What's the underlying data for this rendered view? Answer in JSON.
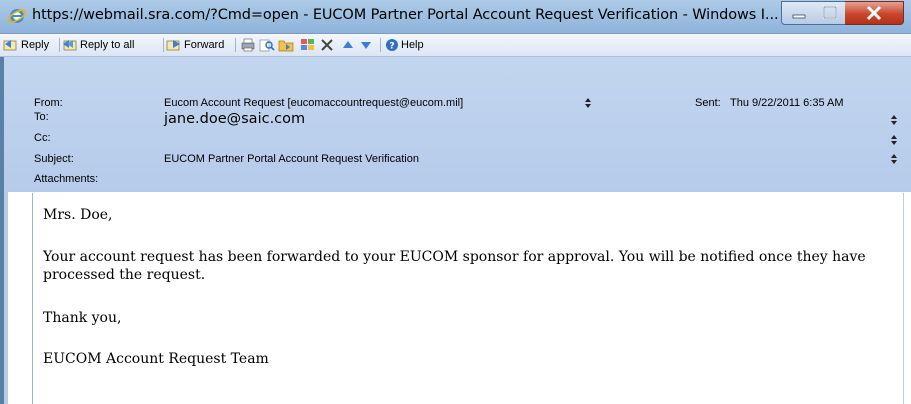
{
  "window": {
    "title": "https://webmail.sra.com/?Cmd=open - EUCOM Partner Portal Account Request Verification - Windows I..."
  },
  "toolbar": {
    "reply": "Reply",
    "reply_all": "Reply to all",
    "forward": "Forward",
    "help": "Help"
  },
  "header": {
    "from_label": "From:",
    "from_value": "Eucom Account Request [eucomaccountrequest@eucom.mil]",
    "sent_label": "Sent:",
    "sent_value": "Thu 9/22/2011 6:35 AM",
    "to_label": "To:",
    "to_value": "jane.doe@saic.com",
    "cc_label": "Cc:",
    "subject_label": "Subject:",
    "subject_value": "EUCOM Partner Portal Account Request Verification",
    "attachments_label": "Attachments:"
  },
  "message": {
    "greeting": "Mrs. Doe,",
    "body_line1": "Your account request has been forwarded to your EUCOM sponsor for approval. You will be notified once they have",
    "body_line2": "processed the request.",
    "closing": "Thank you,",
    "signature": "EUCOM Account Request Team"
  },
  "colors": {
    "titlebar": "#9ec0e2",
    "header": "#bed2ee",
    "close_button": "#c9462c"
  }
}
